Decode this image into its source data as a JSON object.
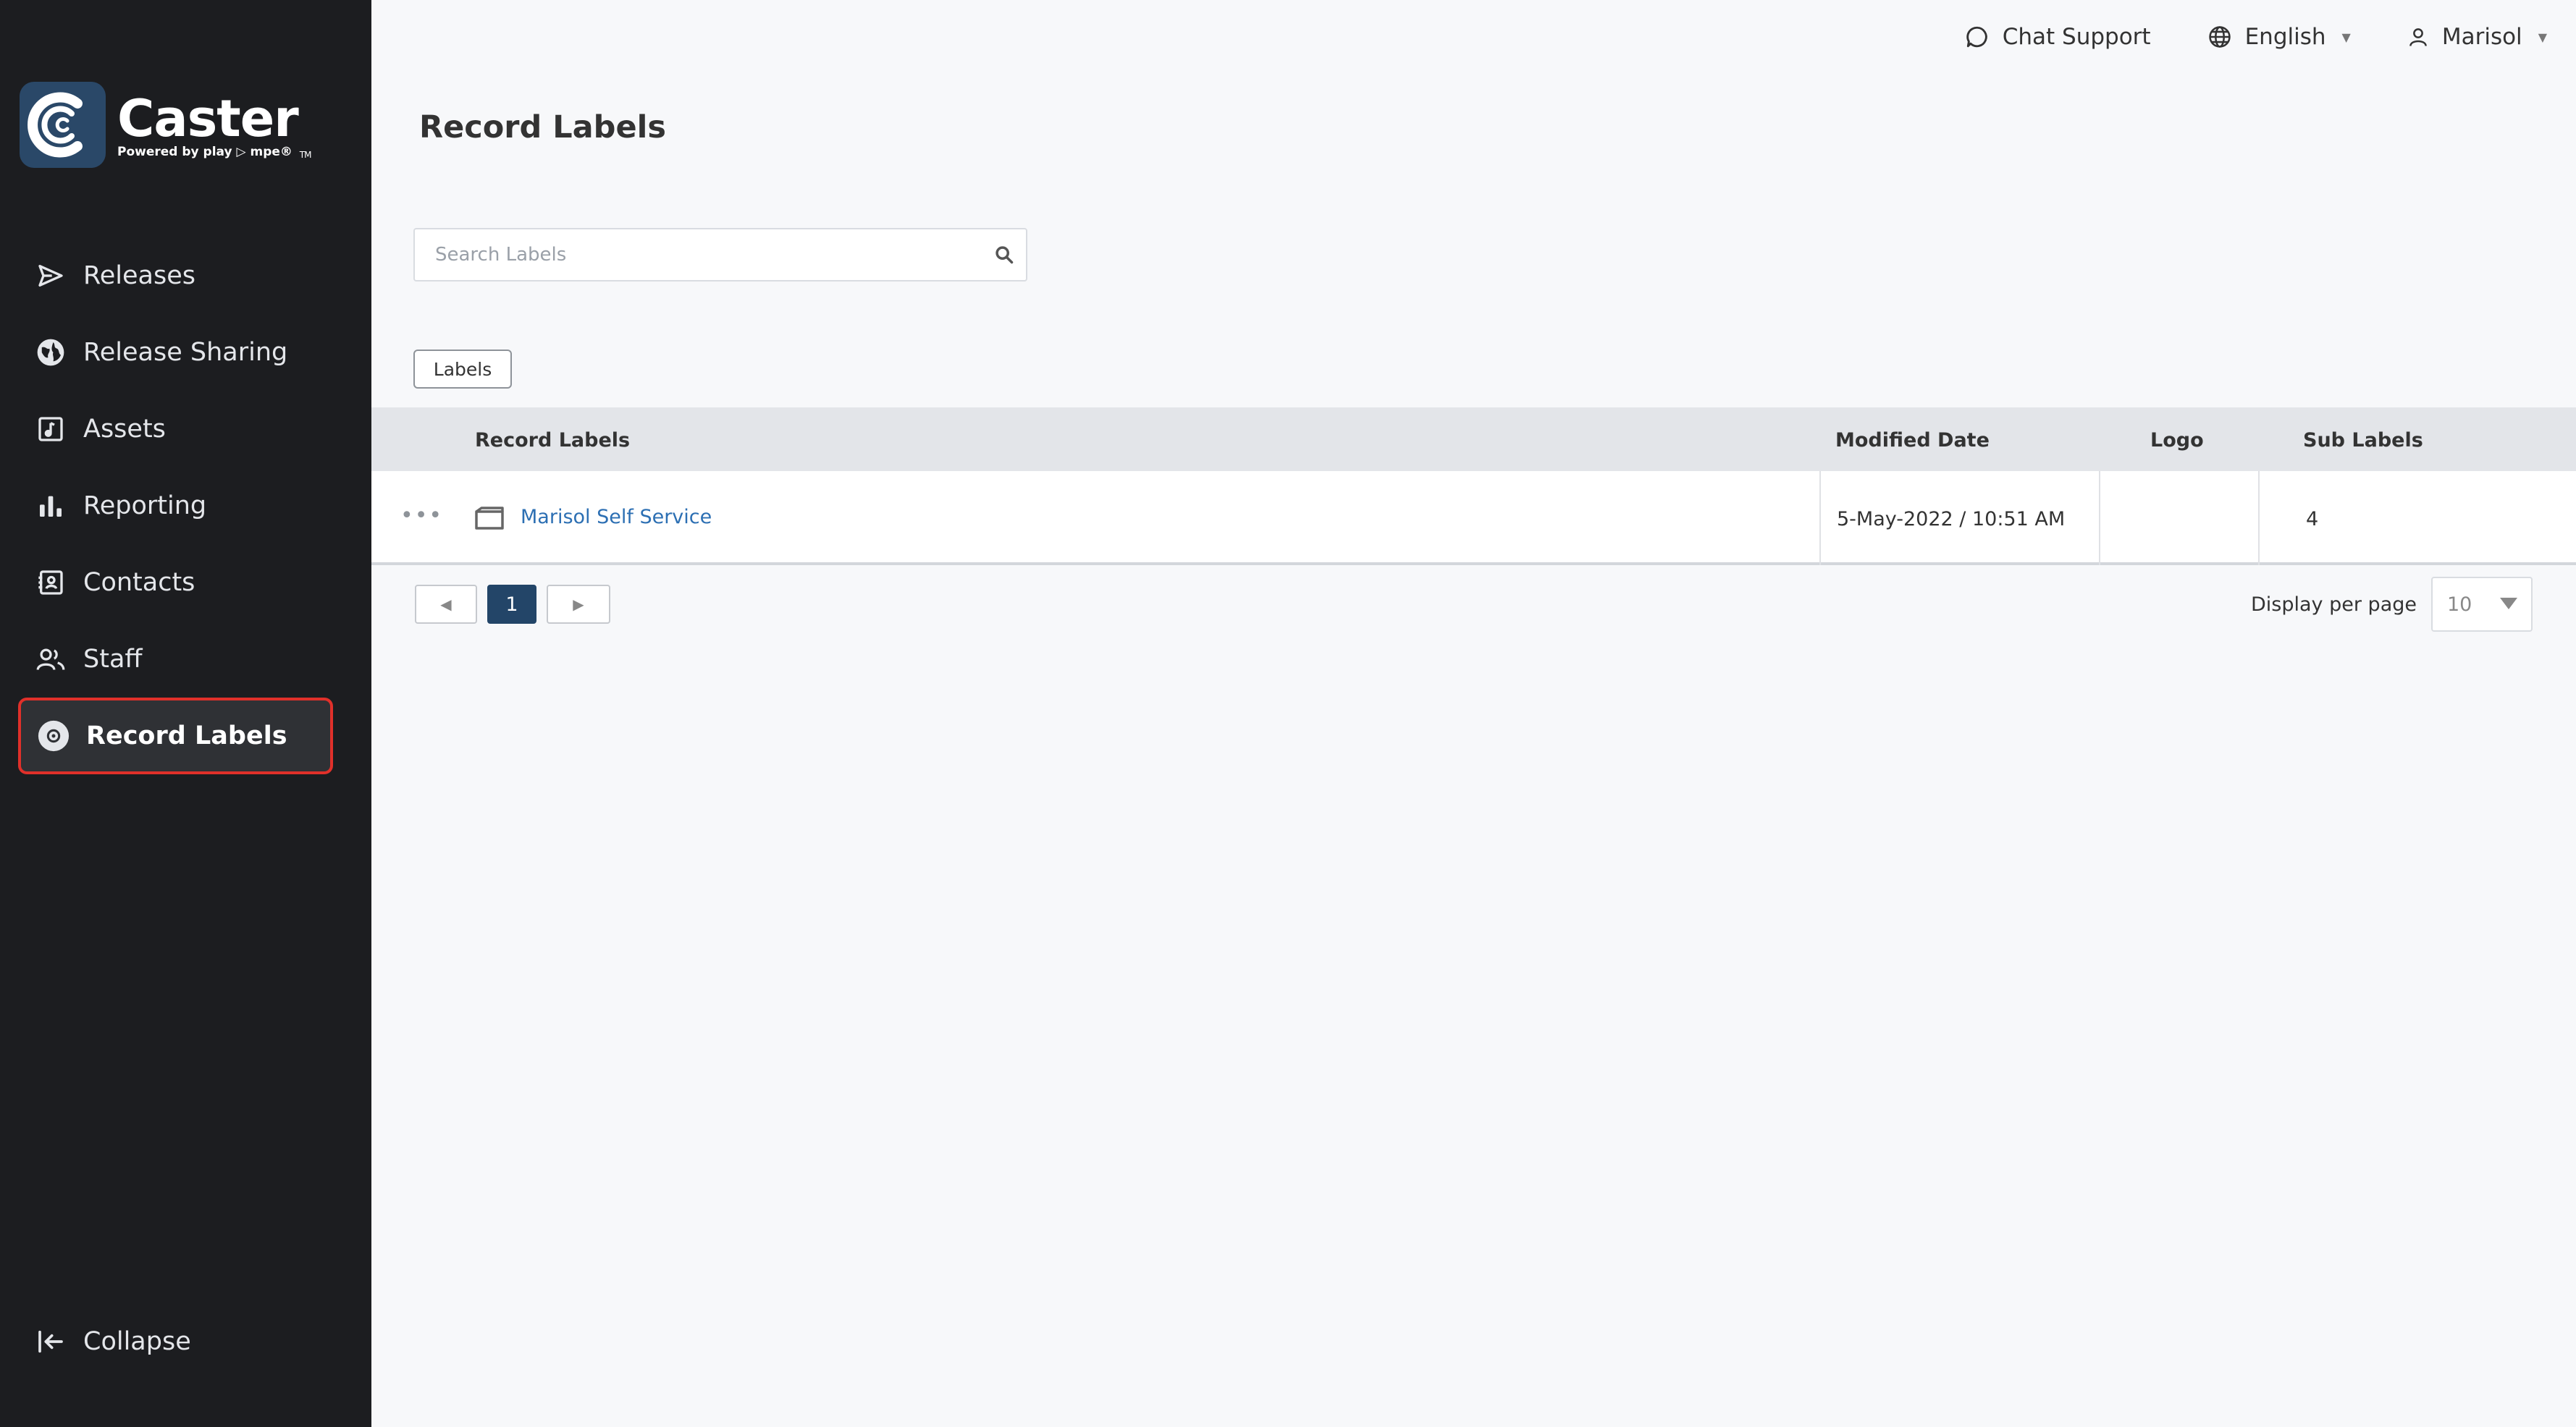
{
  "brand": {
    "name": "Caster",
    "trademark": "TM",
    "tagline": "Powered by play ▷ mpe®",
    "mark_color": "#2a4868"
  },
  "sidebar": {
    "items": [
      {
        "label": "Releases",
        "icon": "send-icon"
      },
      {
        "label": "Release Sharing",
        "icon": "globe-icon"
      },
      {
        "label": "Assets",
        "icon": "music-file-icon"
      },
      {
        "label": "Reporting",
        "icon": "bar-chart-icon"
      },
      {
        "label": "Contacts",
        "icon": "contact-book-icon"
      },
      {
        "label": "Staff",
        "icon": "people-icon"
      },
      {
        "label": "Record Labels",
        "icon": "vinyl-record-icon",
        "active": true
      }
    ],
    "collapse_label": "Collapse",
    "active_border_color": "#e0302a"
  },
  "topbar": {
    "chat_support": "Chat Support",
    "language": "English",
    "user": "Marisol"
  },
  "page": {
    "title": "Record Labels",
    "search_placeholder": "Search Labels",
    "filter_button": "Labels"
  },
  "table": {
    "headers": {
      "name": "Record Labels",
      "modified": "Modified Date",
      "logo": "Logo",
      "sub_labels": "Sub Labels"
    },
    "rows": [
      {
        "actions": "•••",
        "name": "Marisol Self Service",
        "modified": "5-May-2022 / 10:51 AM",
        "logo": "",
        "sub_labels": "4"
      }
    ]
  },
  "pagination": {
    "current_page": "1",
    "per_page_label": "Display per page",
    "per_page_value": "10"
  }
}
